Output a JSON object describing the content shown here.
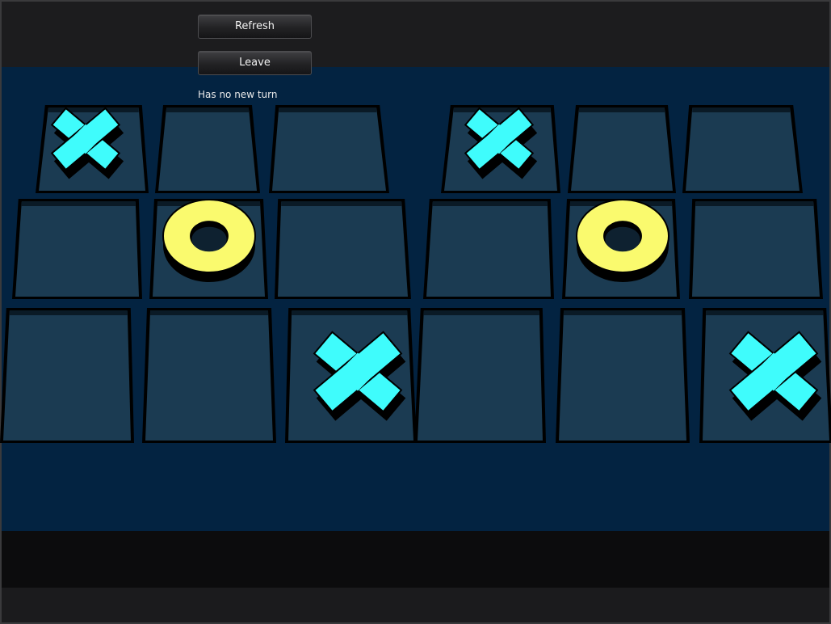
{
  "toolbar": {
    "refresh_label": "Refresh",
    "leave_label": "Leave"
  },
  "status": {
    "text": "Has no new turn"
  },
  "boards": [
    {
      "name": "left-board",
      "cells": [
        "X",
        "",
        "",
        "",
        "O",
        "",
        "",
        "",
        "X"
      ]
    },
    {
      "name": "right-board",
      "cells": [
        "X",
        "",
        "",
        "",
        "O",
        "",
        "",
        "",
        "X"
      ]
    }
  ],
  "colors": {
    "x_piece": "#3ffcfc",
    "o_piece": "#fafa6e",
    "board_bg": "#032341",
    "cell_fill": "#1b3b52"
  },
  "icons": {
    "x_piece": "x-piece-icon",
    "o_piece": "o-piece-icon"
  }
}
